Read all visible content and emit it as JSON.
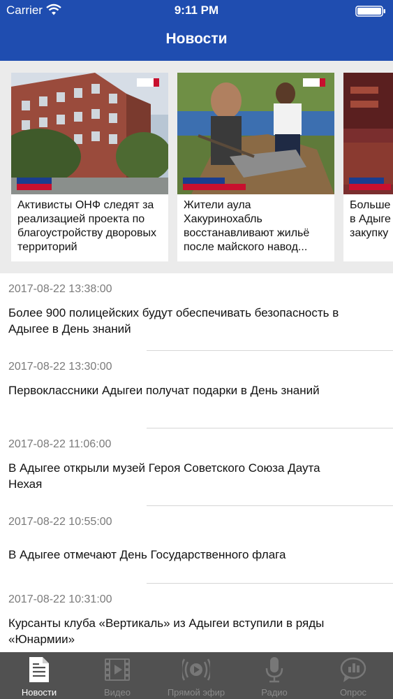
{
  "status_bar": {
    "carrier": "Carrier",
    "time": "9:11 PM"
  },
  "nav": {
    "title": "Новости"
  },
  "featured": [
    {
      "caption": "Активисты ОНФ следят за реализацией проекта по благоустройству дворовых территорий"
    },
    {
      "caption": "Жители аула Хакуринохабль восстанавливают жильё после майского навод..."
    },
    {
      "caption": "Больше\nв Адыге\nзакупку"
    }
  ],
  "news": [
    {
      "date": "2017-08-22 13:38:00",
      "title": "Более 900 полицейских будут обеспечивать безопасность в Адыгее в День знаний"
    },
    {
      "date": "2017-08-22 13:30:00",
      "title": "Первоклассники Адыгеи получат подарки в День знаний"
    },
    {
      "date": "2017-08-22 11:06:00",
      "title": "В Адыгее открыли музей Героя Советского Союза Даута Нехая"
    },
    {
      "date": "2017-08-22 10:55:00",
      "title": "В Адыгее отмечают День Государственного флага"
    },
    {
      "date": "2017-08-22 10:31:00",
      "title": "Курсанты клуба «Вертикаль» из Адыгеи вступили в ряды «Юнармии»"
    }
  ],
  "tabs": [
    {
      "label": "Новости",
      "icon": "document-icon",
      "active": true
    },
    {
      "label": "Видео",
      "icon": "film-icon",
      "active": false
    },
    {
      "label": "Прямой эфир",
      "icon": "live-broadcast-icon",
      "active": false
    },
    {
      "label": "Радио",
      "icon": "microphone-icon",
      "active": false
    },
    {
      "label": "Опрос",
      "icon": "poll-chat-icon",
      "active": false
    }
  ],
  "colors": {
    "header": "#1f4db0",
    "tabbar": "#515151",
    "featured_bg": "#ebebeb"
  }
}
